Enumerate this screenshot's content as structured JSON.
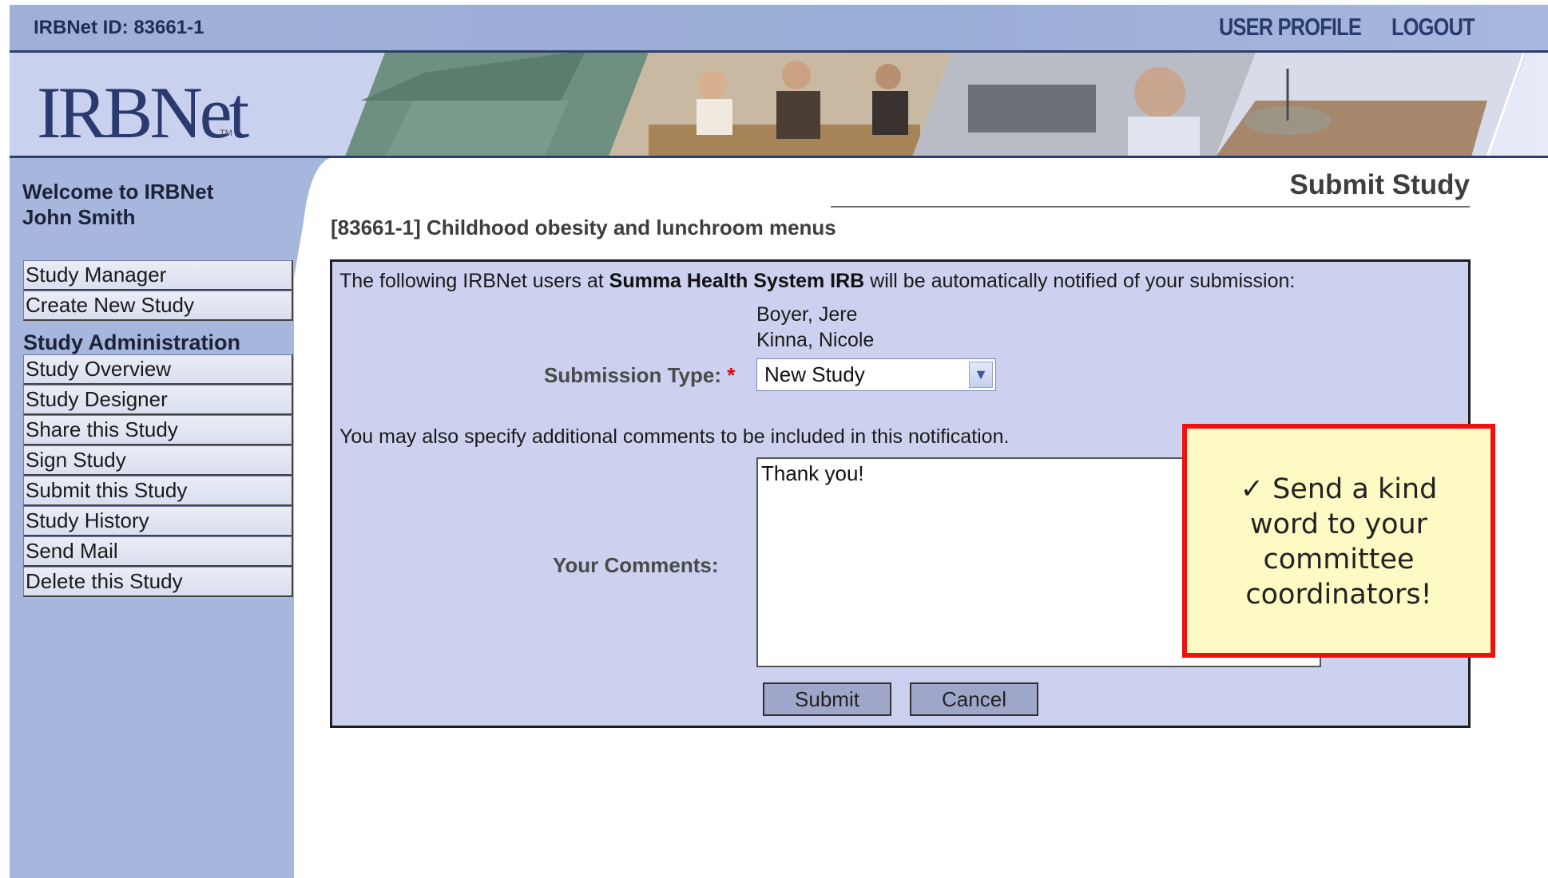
{
  "header": {
    "irbnet_id": "IRBNet ID: 83661-1",
    "user_profile": "USER PROFILE",
    "logout": "LOGOUT",
    "logo_text": "IRBNet",
    "logo_tm": "TM"
  },
  "sidebar": {
    "welcome_line1": "Welcome to IRBNet",
    "welcome_line2": "John Smith",
    "top_items": [
      {
        "label": "Study Manager"
      },
      {
        "label": "Create New Study"
      }
    ],
    "admin_heading": "Study Administration",
    "admin_items": [
      {
        "label": "Study Overview"
      },
      {
        "label": "Study Designer"
      },
      {
        "label": "Share this Study"
      },
      {
        "label": "Sign Study"
      },
      {
        "label": "Submit this Study"
      },
      {
        "label": "Study History"
      },
      {
        "label": "Send Mail"
      },
      {
        "label": "Delete this Study"
      }
    ]
  },
  "main": {
    "page_title": "Submit Study",
    "study_title": "[83661-1] Childhood obesity and lunchroom menus",
    "notice_prefix": "The following IRBNet users at ",
    "notice_org": "Summa Health System IRB",
    "notice_suffix": " will be automatically notified of your submission:",
    "notified_users": [
      "Boyer, Jere",
      "Kinna, Nicole"
    ],
    "submission_type_label": "Submission Type:",
    "required_marker": "*",
    "submission_type_value": "New Study",
    "comments_note": "You may also specify additional comments to be included in this notification.",
    "comments_label": "Your Comments:",
    "comments_value": "Thank you!",
    "submit_label": "Submit",
    "cancel_label": "Cancel"
  },
  "callout": {
    "line1": "✓ Send a kind",
    "line2": "word to your",
    "line3": "committee",
    "line4": "coordinators!"
  },
  "colors": {
    "accent": "#2d3f6b",
    "panel": "#cbd1ee",
    "sidebar": "#a7b6dd",
    "callout_border": "#ee1111",
    "callout_bg": "#fdfbc3",
    "required": "#e00000"
  }
}
